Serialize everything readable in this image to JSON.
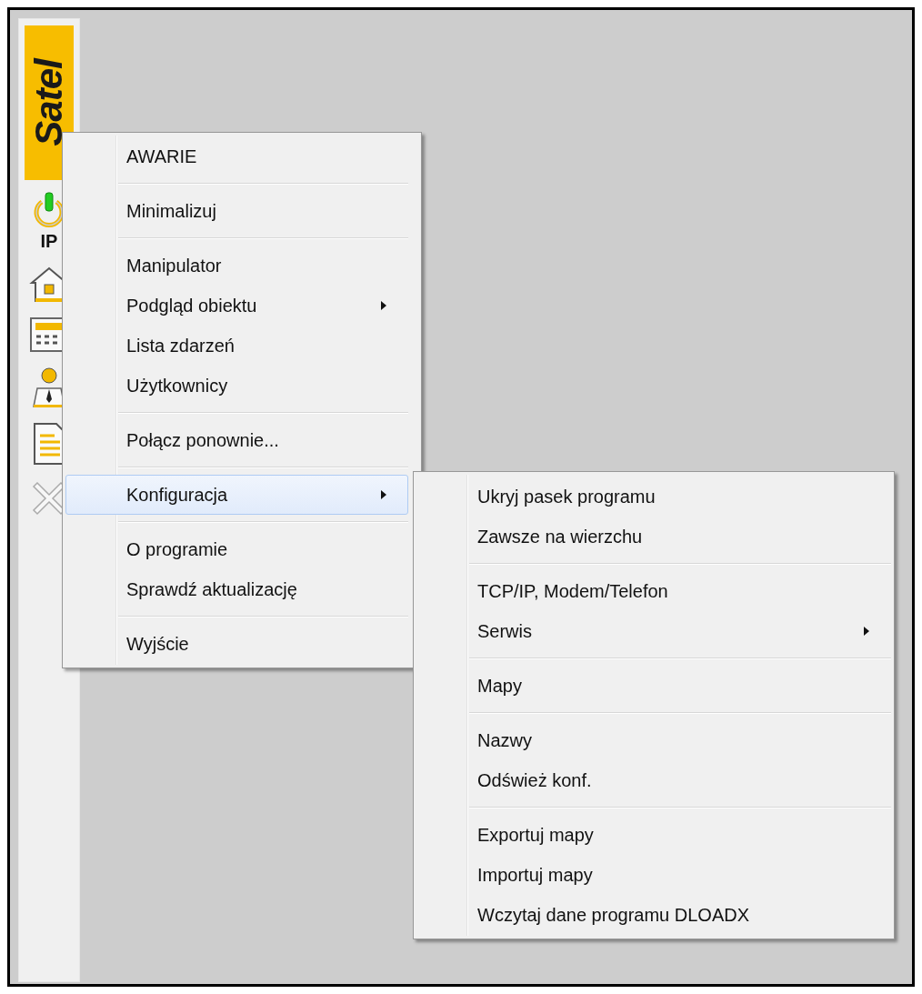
{
  "sidebar": {
    "logo": "Satel",
    "connection_label": "IP",
    "tools": [
      {
        "kind": "power"
      },
      {
        "kind": "house"
      },
      {
        "kind": "keypad"
      },
      {
        "kind": "user"
      },
      {
        "kind": "document"
      },
      {
        "kind": "close"
      }
    ]
  },
  "menu": {
    "groups": [
      [
        {
          "label": "AWARIE",
          "submenu": false,
          "selected": false
        }
      ],
      [
        {
          "label": "Minimalizuj",
          "submenu": false,
          "selected": false
        }
      ],
      [
        {
          "label": "Manipulator",
          "submenu": false,
          "selected": false
        },
        {
          "label": "Podgląd obiektu",
          "submenu": true,
          "selected": false
        },
        {
          "label": "Lista zdarzeń",
          "submenu": false,
          "selected": false
        },
        {
          "label": "Użytkownicy",
          "submenu": false,
          "selected": false
        }
      ],
      [
        {
          "label": "Połącz ponownie...",
          "submenu": false,
          "selected": false
        }
      ],
      [
        {
          "label": "Konfiguracja",
          "submenu": true,
          "selected": true
        }
      ],
      [
        {
          "label": "O programie",
          "submenu": false,
          "selected": false
        },
        {
          "label": "Sprawdź aktualizację",
          "submenu": false,
          "selected": false
        }
      ],
      [
        {
          "label": "Wyjście",
          "submenu": false,
          "selected": false
        }
      ]
    ]
  },
  "submenu": {
    "groups": [
      [
        {
          "label": "Ukryj pasek programu",
          "submenu": false,
          "selected": false
        },
        {
          "label": "Zawsze na wierzchu",
          "submenu": false,
          "selected": false
        }
      ],
      [
        {
          "label": "TCP/IP, Modem/Telefon",
          "submenu": false,
          "selected": false
        },
        {
          "label": "Serwis",
          "submenu": true,
          "selected": false
        }
      ],
      [
        {
          "label": "Mapy",
          "submenu": false,
          "selected": false
        }
      ],
      [
        {
          "label": "Nazwy",
          "submenu": false,
          "selected": false
        },
        {
          "label": "Odśwież konf.",
          "submenu": false,
          "selected": false
        }
      ],
      [
        {
          "label": "Exportuj mapy",
          "submenu": false,
          "selected": false
        },
        {
          "label": "Importuj mapy",
          "submenu": false,
          "selected": false
        },
        {
          "label": "Wczytaj dane programu DLOADX",
          "submenu": false,
          "selected": false
        }
      ]
    ]
  }
}
